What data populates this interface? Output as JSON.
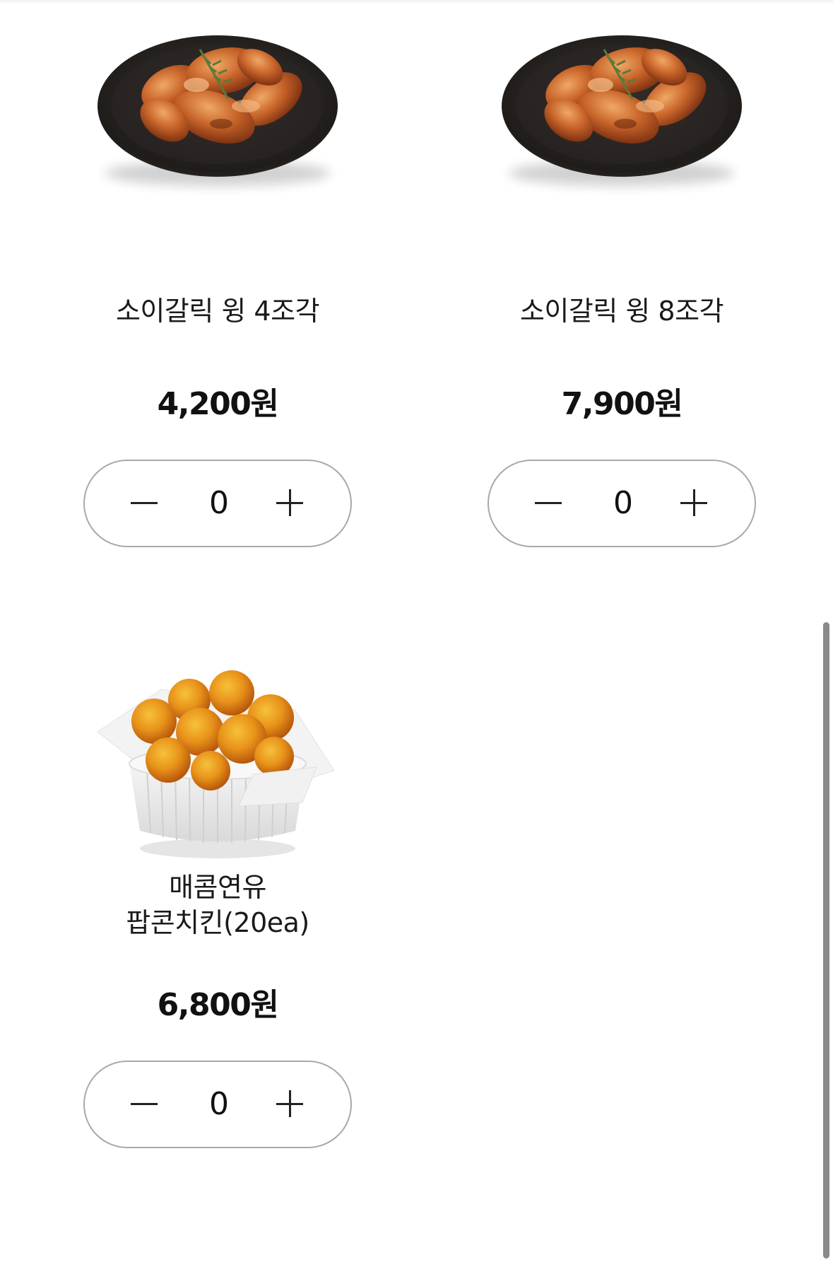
{
  "products": [
    {
      "name": "소이갈릭 윙 4조각",
      "price": "4,200원",
      "quantity": "0",
      "image": "garlic-wings-plate"
    },
    {
      "name": "소이갈릭 윙 8조각",
      "price": "7,900원",
      "quantity": "0",
      "image": "garlic-wings-plate"
    },
    {
      "name_line1": "매콤연유",
      "name_line2": "팝콘치킨(20ea)",
      "price": "6,800원",
      "quantity": "0",
      "image": "popcorn-chicken-bowl"
    }
  ],
  "icons": {
    "decrease": "minus-icon",
    "increase": "plus-icon"
  },
  "colors": {
    "stepper_border": "#a9a9a9",
    "text": "#111111",
    "background": "#ffffff",
    "scrollbar": "#8a8a8a"
  }
}
